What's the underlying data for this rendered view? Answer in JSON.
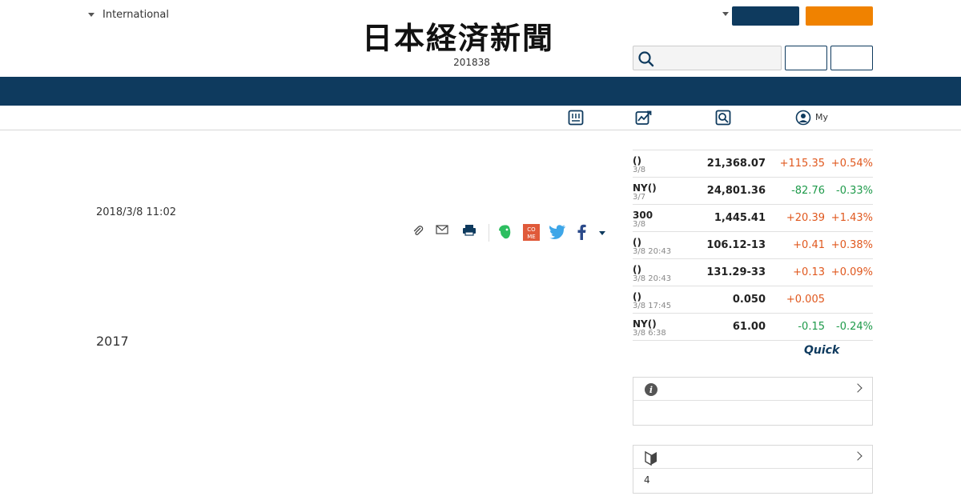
{
  "header": {
    "edition_label": "International",
    "logo_text": "日本経済新聞",
    "date_line": "201838",
    "search": {
      "placeholder": ""
    }
  },
  "subnav": {
    "items": [
      {
        "icon": "newspaper-icon"
      },
      {
        "icon": "market-chart-icon"
      },
      {
        "icon": "search-square-icon"
      },
      {
        "icon": "user-circle-icon",
        "label": "My"
      }
    ]
  },
  "article": {
    "timestamp": "2018/3/8 11:02",
    "body_fragment": "2017",
    "share_icons": [
      "clip-icon",
      "mail-icon",
      "print-icon",
      "evernote-icon",
      "come-icon",
      "twitter-icon",
      "facebook-icon",
      "more-caret-icon"
    ]
  },
  "market": {
    "rows": [
      {
        "name": "()",
        "time": "3/8",
        "value": "21,368.07",
        "change": "+115.35",
        "pct": "+0.54%",
        "dir": "up"
      },
      {
        "name": "NY()",
        "time": "3/7",
        "value": "24,801.36",
        "change": "-82.76",
        "pct": "-0.33%",
        "dir": "down"
      },
      {
        "name": "300",
        "time": "3/8",
        "value": "1,445.41",
        "change": "+20.39",
        "pct": "+1.43%",
        "dir": "up"
      },
      {
        "name": "()",
        "time": "3/8 20:43",
        "value": "106.12-13",
        "change": "+0.41",
        "pct": "+0.38%",
        "dir": "up"
      },
      {
        "name": "()",
        "time": "3/8 20:43",
        "value": "131.29-33",
        "change": "+0.13",
        "pct": "+0.09%",
        "dir": "up"
      },
      {
        "name": "()",
        "time": "3/8 17:45",
        "value": "0.050",
        "change": "+0.005",
        "pct": "",
        "dir": "up"
      },
      {
        "name": "NY()",
        "time": "3/8 6:38",
        "value": "61.00",
        "change": "-0.15",
        "pct": "-0.24%",
        "dir": "down"
      }
    ],
    "provider": "Quick"
  },
  "boxes": [
    {
      "icon": "info-icon",
      "body": ""
    },
    {
      "icon": "beginner-mark-icon",
      "body": "4"
    }
  ],
  "colors": {
    "navy": "#0e3a5e",
    "orange": "#f08200",
    "up": "#e0581e",
    "down": "#1e9a4a"
  }
}
